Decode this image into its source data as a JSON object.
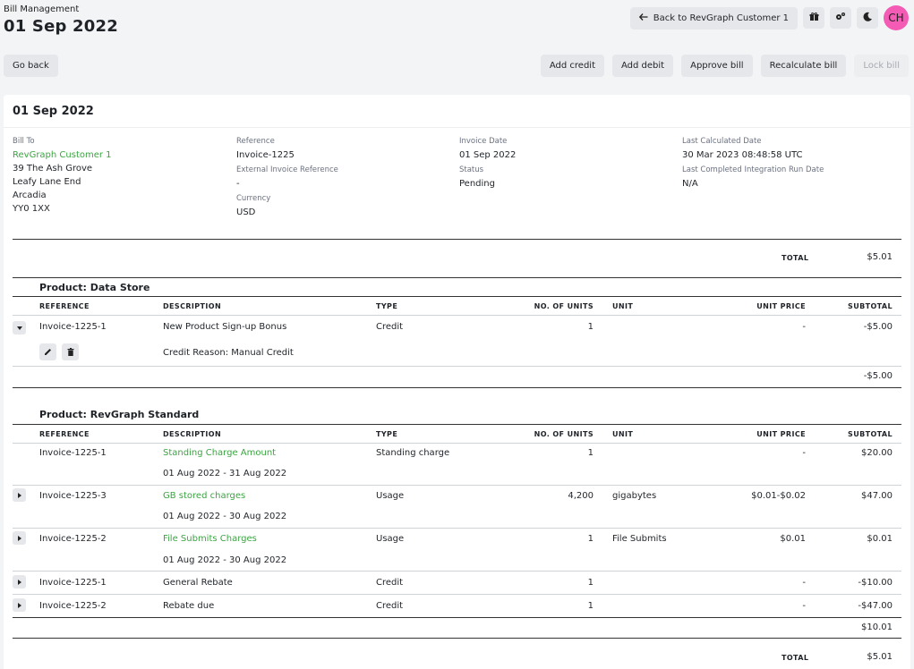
{
  "header": {
    "breadcrumb": "Bill Management",
    "title": "01 Sep 2022",
    "back_label": "Back to RevGraph Customer 1",
    "avatar_initials": "CH"
  },
  "actions": {
    "go_back": "Go back",
    "add_credit": "Add credit",
    "add_debit": "Add debit",
    "approve": "Approve bill",
    "recalculate": "Recalculate bill",
    "lock": "Lock bill"
  },
  "bill": {
    "title": "01 Sep 2022",
    "bill_to_label": "Bill To",
    "customer": "RevGraph Customer 1",
    "address": [
      "39 The Ash Grove",
      "Leafy Lane End",
      "Arcadia",
      "YY0 1XX"
    ],
    "reference_label": "Reference",
    "reference": "Invoice-1225",
    "ext_ref_label": "External Invoice Reference",
    "ext_ref": "-",
    "currency_label": "Currency",
    "currency": "USD",
    "invoice_date_label": "Invoice Date",
    "invoice_date": "01 Sep 2022",
    "status_label": "Status",
    "status": "Pending",
    "last_calc_label": "Last Calculated Date",
    "last_calc": "30 Mar 2023 08:48:58 UTC",
    "last_run_label": "Last Completed Integration Run Date",
    "last_run": "N/A",
    "total_label": "TOTAL",
    "total": "$5.01"
  },
  "columns": {
    "reference": "REFERENCE",
    "description": "DESCRIPTION",
    "type": "TYPE",
    "units": "NO. OF UNITS",
    "unit": "UNIT",
    "unit_price": "UNIT PRICE",
    "subtotal": "SUBTOTAL"
  },
  "products": [
    {
      "name": "Product: Data Store",
      "rows": [
        {
          "reference": "Invoice-1225-1",
          "description": "New Product Sign-up Bonus",
          "type": "Credit",
          "units": "1",
          "unit": "",
          "unit_price": "-",
          "subtotal": "-$5.00",
          "detail": "Credit Reason: Manual Credit"
        }
      ],
      "subtotal": "-$5.00"
    },
    {
      "name": "Product: RevGraph Standard",
      "rows": [
        {
          "reference": "Invoice-1225-1",
          "description": "Standing Charge Amount",
          "type": "Standing charge",
          "units": "1",
          "unit": "",
          "unit_price": "-",
          "subtotal": "$20.00",
          "detail": "01 Aug 2022 - 31 Aug 2022"
        },
        {
          "reference": "Invoice-1225-3",
          "description": "GB stored charges",
          "type": "Usage",
          "units": "4,200",
          "unit": "gigabytes",
          "unit_price": "$0.01-$0.02",
          "subtotal": "$47.00",
          "detail": "01 Aug 2022 - 30 Aug 2022"
        },
        {
          "reference": "Invoice-1225-2",
          "description": "File Submits Charges",
          "type": "Usage",
          "units": "1",
          "unit": "File Submits",
          "unit_price": "$0.01",
          "subtotal": "$0.01",
          "detail": "01 Aug 2022 - 30 Aug 2022"
        },
        {
          "reference": "Invoice-1225-1",
          "description": "General Rebate",
          "type": "Credit",
          "units": "1",
          "unit": "",
          "unit_price": "-",
          "subtotal": "-$10.00"
        },
        {
          "reference": "Invoice-1225-2",
          "description": "Rebate due",
          "type": "Credit",
          "units": "1",
          "unit": "",
          "unit_price": "-",
          "subtotal": "-$47.00"
        }
      ],
      "subtotal": "$10.01"
    }
  ],
  "footer": {
    "total_label": "TOTAL",
    "total": "$5.01"
  },
  "icons": {
    "back": "arrow-left-icon",
    "gift": "gift-icon",
    "settings": "settings-icon",
    "theme": "moon-icon",
    "expand": "caret-icon",
    "edit": "pencil-icon",
    "delete": "trash-icon"
  },
  "colors": {
    "link_green": "#3aa540",
    "avatar_pink": "#f45bb4"
  }
}
